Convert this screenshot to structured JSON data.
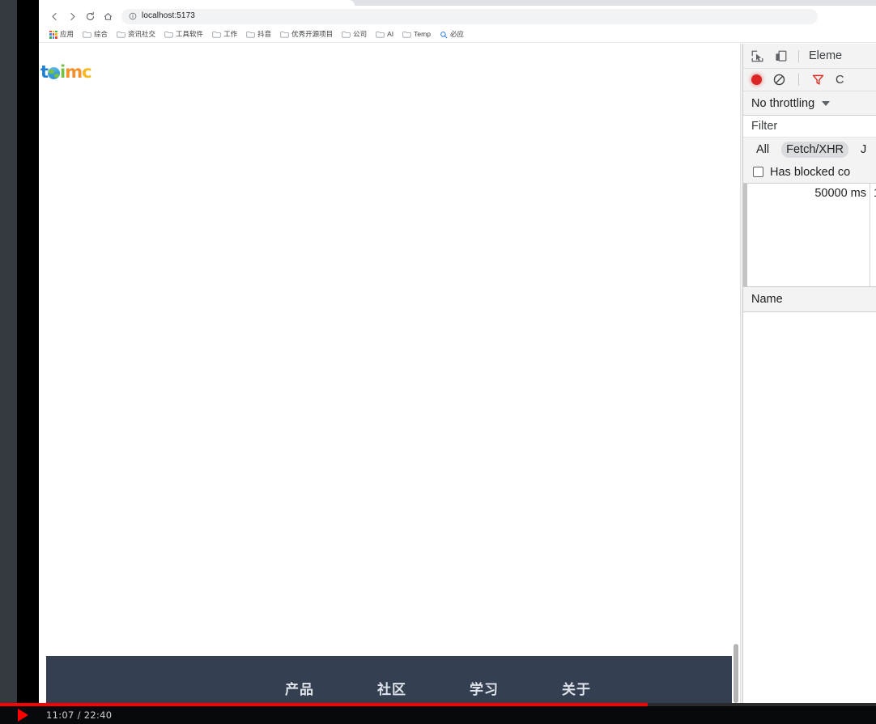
{
  "browser": {
    "nav": {
      "back_icon": "arrow-left-icon",
      "forward_icon": "arrow-right-icon",
      "reload_icon": "reload-icon",
      "home_icon": "home-icon"
    },
    "omnibox": {
      "url": "localhost:5173",
      "site_info_icon": "info-circle-icon"
    },
    "bookmarks": [
      {
        "label": "应用",
        "icon": "apps-grid-icon"
      },
      {
        "label": "综合",
        "icon": "folder-icon"
      },
      {
        "label": "资讯社交",
        "icon": "folder-icon"
      },
      {
        "label": "工具软件",
        "icon": "folder-icon"
      },
      {
        "label": "工作",
        "icon": "folder-icon"
      },
      {
        "label": "抖音",
        "icon": "folder-icon"
      },
      {
        "label": "优秀开源项目",
        "icon": "folder-icon"
      },
      {
        "label": "公司",
        "icon": "folder-icon"
      },
      {
        "label": "AI",
        "icon": "folder-icon"
      },
      {
        "label": "Temp",
        "icon": "folder-icon"
      },
      {
        "label": "必应",
        "icon": "search-icon"
      }
    ]
  },
  "page": {
    "logo": {
      "letters": [
        {
          "char": "t",
          "color": "#1f7fd0"
        },
        {
          "char": "o",
          "color": "#3aa0d8"
        },
        {
          "char": "i",
          "color": "#76c043"
        },
        {
          "char": "m",
          "color": "#f3902a"
        },
        {
          "char": "c",
          "color": "#f5b820"
        }
      ]
    },
    "footer": {
      "background": "#343f51",
      "nav": [
        {
          "label": "产品"
        },
        {
          "label": "社区"
        },
        {
          "label": "学习"
        },
        {
          "label": "关于"
        }
      ]
    },
    "scrollbar": {
      "name": "page-scrollbar"
    }
  },
  "devtools": {
    "toolbar": {
      "inspect_icon": "inspect-element-icon",
      "device_icon": "device-toolbar-icon",
      "active_panel": "Eleme"
    },
    "network": {
      "record_icon": "record-button-icon",
      "clear_icon": "clear-network-icon",
      "filter_icon": "filter-funnel-icon",
      "search_label": "C",
      "throttling": "No throttling",
      "throttling_caret": "chevron-down-icon",
      "filter_placeholder": "Filter",
      "types": [
        {
          "label": "All",
          "selected": false
        },
        {
          "label": "Fetch/XHR",
          "selected": true
        },
        {
          "label": "J",
          "selected": false
        }
      ],
      "blocked_checkbox_label": "Has blocked co",
      "overview_ticks": [
        {
          "label": "50000 ms"
        },
        {
          "label": "1"
        }
      ],
      "table_columns": [
        {
          "label": "Name"
        }
      ],
      "rows": []
    }
  },
  "video": {
    "play_icon": "play-button-icon",
    "timecode": "11:07 / 22:40",
    "progress_color": "#ff0000"
  }
}
